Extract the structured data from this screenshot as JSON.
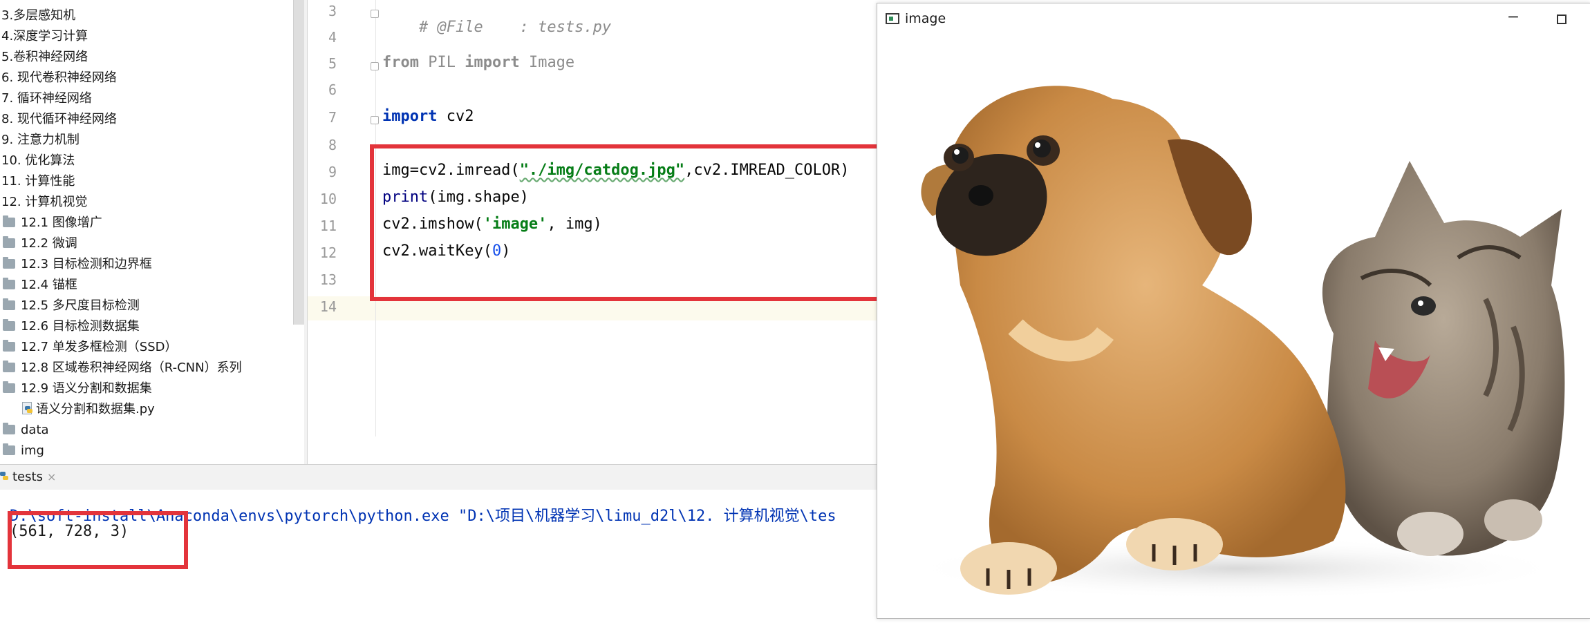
{
  "project_tree": {
    "items": [
      {
        "label": "3.多层感知机",
        "type": "chapter"
      },
      {
        "label": "4.深度学习计算",
        "type": "chapter"
      },
      {
        "label": "5.卷积神经网络",
        "type": "chapter"
      },
      {
        "label": "6. 现代卷积神经网络",
        "type": "chapter"
      },
      {
        "label": "7. 循环神经网络",
        "type": "chapter"
      },
      {
        "label": "8. 现代循环神经网络",
        "type": "chapter"
      },
      {
        "label": "9. 注意力机制",
        "type": "chapter"
      },
      {
        "label": "10. 优化算法",
        "type": "chapter"
      },
      {
        "label": "11. 计算性能",
        "type": "chapter"
      },
      {
        "label": "12. 计算机视觉",
        "type": "chapter"
      },
      {
        "label": "12.1 图像增广",
        "type": "folder"
      },
      {
        "label": "12.2 微调",
        "type": "folder"
      },
      {
        "label": "12.3 目标检测和边界框",
        "type": "folder"
      },
      {
        "label": "12.4 锚框",
        "type": "folder"
      },
      {
        "label": "12.5 多尺度目标检测",
        "type": "folder"
      },
      {
        "label": "12.6 目标检测数据集",
        "type": "folder"
      },
      {
        "label": "12.7 单发多框检测（SSD）",
        "type": "folder"
      },
      {
        "label": "12.8 区域卷积神经网络（R-CNN）系列",
        "type": "folder"
      },
      {
        "label": "12.9 语义分割和数据集",
        "type": "folder"
      },
      {
        "label": "语义分割和数据集.py",
        "type": "pyfile"
      },
      {
        "label": "data",
        "type": "folder"
      },
      {
        "label": "img",
        "type": "folder"
      }
    ]
  },
  "editor": {
    "line_numbers": [
      "3",
      "4",
      "5",
      "6",
      "7",
      "8",
      "9",
      "10",
      "11",
      "12",
      "13",
      "14"
    ],
    "lines": {
      "l3_comment": "# @File    : tests.py",
      "l5_from": "from",
      "l5_module": " PIL ",
      "l5_import": "import",
      "l5_name": " Image",
      "l7_import": "import",
      "l7_name": " cv2",
      "l9_pre": "img=cv2.imread(",
      "l9_str": "\"./img/catdog.jpg\"",
      "l9_post": ",cv2.IMREAD_COLOR)",
      "l10_fn": "print",
      "l10_rest": "(img.shape)",
      "l11_pre": "cv2.imshow(",
      "l11_str": "'image'",
      "l11_post": ", img)",
      "l12_pre": "cv2.waitKey(",
      "l12_num": "0",
      "l12_post": ")"
    }
  },
  "run_panel": {
    "tab_label": "tests",
    "tab_close": "×",
    "command_line": "D:\\soft-install\\Anaconda\\envs\\pytorch\\python.exe \"D:\\项目\\机器学习\\limu_d2l\\12. 计算机视觉\\tes",
    "output_line": "(561, 728, 3)"
  },
  "image_window": {
    "title": "image",
    "minimize": "─",
    "photo_alt": "puppy and kitten"
  },
  "colors": {
    "annotation_red": "#e3343b",
    "keyword": "#0033b3",
    "string": "#067d17",
    "number": "#1750eb",
    "comment": "#8c8c8c"
  }
}
